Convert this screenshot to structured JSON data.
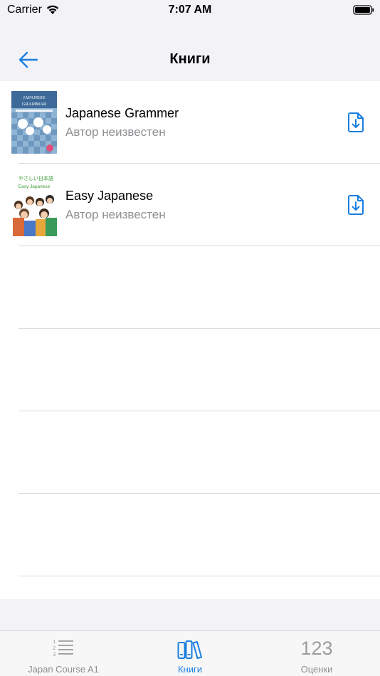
{
  "status_bar": {
    "carrier": "Carrier",
    "time": "7:07 AM"
  },
  "nav": {
    "title": "Книги",
    "back_icon": "arrow-left-icon"
  },
  "books": [
    {
      "title": "Japanese Grammer",
      "author": "Автор неизвестен",
      "cover_title_line1": "JAPANESE",
      "cover_title_line2": "GRAMMAR"
    },
    {
      "title": "Easy Japanese",
      "author": "Автор неизвестен",
      "cover_top": "やさしい日本語",
      "cover_sub": "Easy Japanese"
    }
  ],
  "tabs": [
    {
      "label": "Japan Course A1",
      "icon": "numbered-list-icon"
    },
    {
      "label": "Книги",
      "icon": "books-icon"
    },
    {
      "label": "Оценки",
      "icon_text": "123"
    }
  ],
  "colors": {
    "accent": "#1a7fe0",
    "secondary_text": "#8e8e93",
    "background": "#f2f2f7"
  }
}
